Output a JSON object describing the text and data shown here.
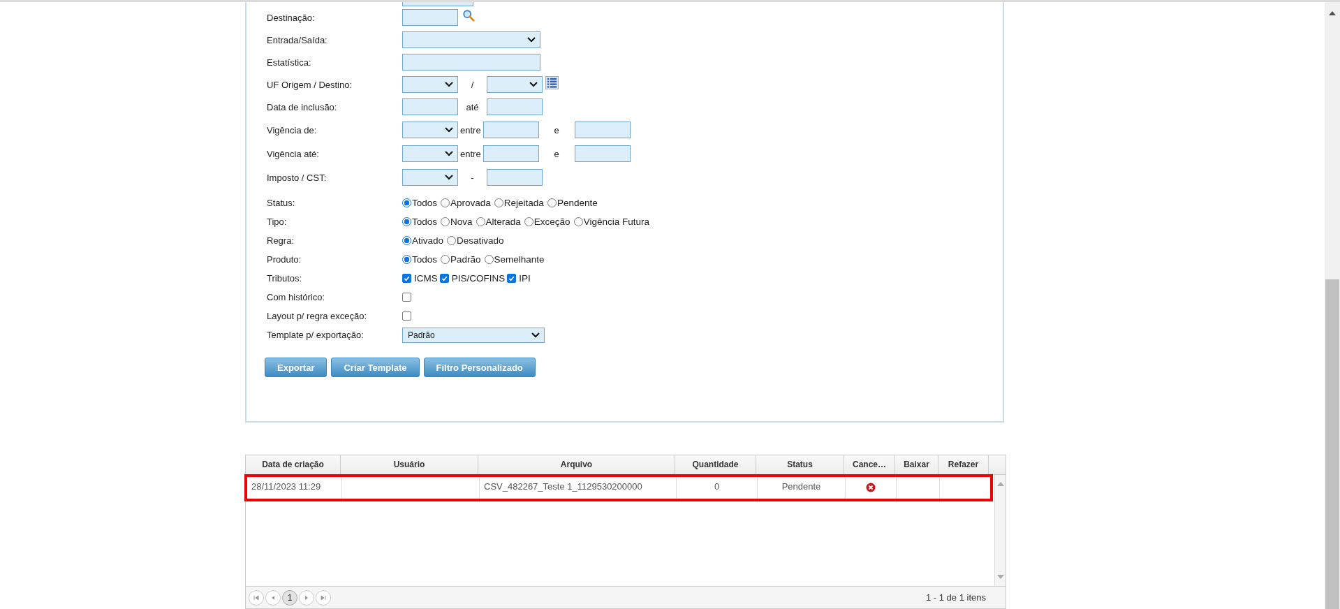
{
  "filters": [
    {
      "kind": "fields",
      "label": "Destinação:",
      "parts": [
        {
          "kind": "input-short"
        },
        {
          "kind": "lookup-icon"
        }
      ]
    },
    {
      "kind": "fields",
      "label": "Entrada/Saída:",
      "parts": [
        {
          "kind": "select-wide"
        }
      ]
    },
    {
      "kind": "fields",
      "label": "Estatística:",
      "parts": [
        {
          "kind": "input-wide"
        }
      ]
    },
    {
      "kind": "fields",
      "label": "UF Origem / Destino:",
      "parts": [
        {
          "kind": "select-short"
        },
        {
          "kind": "text",
          "text": "/"
        },
        {
          "kind": "select-short"
        },
        {
          "kind": "list-icon"
        }
      ]
    },
    {
      "kind": "fields",
      "label": "Data de inclusão:",
      "parts": [
        {
          "kind": "input-short"
        },
        {
          "kind": "text",
          "text": "até"
        },
        {
          "kind": "input-short"
        }
      ]
    },
    {
      "kind": "fields",
      "label": "Vigência de:",
      "parts": [
        {
          "kind": "select-short"
        },
        {
          "kind": "text-tight",
          "text": "entre"
        },
        {
          "kind": "input-short"
        },
        {
          "kind": "text-wide",
          "text": "e"
        },
        {
          "kind": "input-short"
        }
      ]
    },
    {
      "kind": "fields",
      "label": "Vigência até:",
      "parts": [
        {
          "kind": "select-short"
        },
        {
          "kind": "text-tight",
          "text": "entre"
        },
        {
          "kind": "input-short"
        },
        {
          "kind": "text-wide",
          "text": "e"
        },
        {
          "kind": "input-short"
        }
      ]
    },
    {
      "kind": "fields",
      "label": "Imposto / CST:",
      "parts": [
        {
          "kind": "select-short"
        },
        {
          "kind": "text",
          "text": "-"
        },
        {
          "kind": "input-short"
        }
      ]
    },
    {
      "kind": "radio",
      "label": "Status:",
      "options": [
        {
          "label": "Todos",
          "selected": true
        },
        {
          "label": "Aprovada",
          "selected": false
        },
        {
          "label": "Rejeitada",
          "selected": false
        },
        {
          "label": "Pendente",
          "selected": false
        }
      ]
    },
    {
      "kind": "radio",
      "label": "Tipo:",
      "options": [
        {
          "label": "Todos",
          "selected": true
        },
        {
          "label": "Nova",
          "selected": false
        },
        {
          "label": "Alterada",
          "selected": false
        },
        {
          "label": "Exceção",
          "selected": false
        },
        {
          "label": "Vigência Futura",
          "selected": false
        }
      ]
    },
    {
      "kind": "radio",
      "label": "Regra:",
      "options": [
        {
          "label": "Ativado",
          "selected": true
        },
        {
          "label": "Desativado",
          "selected": false
        }
      ]
    },
    {
      "kind": "radio",
      "label": "Produto:",
      "options": [
        {
          "label": "Todos",
          "selected": true
        },
        {
          "label": "Padrão",
          "selected": false
        },
        {
          "label": "Semelhante",
          "selected": false
        }
      ]
    },
    {
      "kind": "checks",
      "label": "Tributos:",
      "options": [
        {
          "label": "ICMS",
          "checked": true
        },
        {
          "label": "PIS/COFINS",
          "checked": true
        },
        {
          "label": "IPI",
          "checked": true
        }
      ]
    },
    {
      "kind": "check",
      "label": "Com histórico:",
      "checked": false
    },
    {
      "kind": "check",
      "label": "Layout p/ regra exceção:",
      "checked": false
    },
    {
      "kind": "select-value",
      "label": "Template p/ exportação:",
      "value": "Padrão"
    }
  ],
  "buttons": [
    "Exportar",
    "Criar Template",
    "Filtro Personalizado"
  ],
  "table": {
    "columns": [
      "Data de criação",
      "Usuário",
      "Arquivo",
      "Quantidade",
      "Status",
      "Cance…",
      "Baixar",
      "Refazer"
    ],
    "rows": [
      {
        "data_de_criacao": "28/11/2023 11:29",
        "arquivo": "CSV_482267_Teste 1_1129530200000",
        "quantidade": "0",
        "status": "Pendente",
        "highlighted": true
      }
    ],
    "pager": {
      "page": "1",
      "summary": "1 - 1 de 1 itens"
    }
  }
}
